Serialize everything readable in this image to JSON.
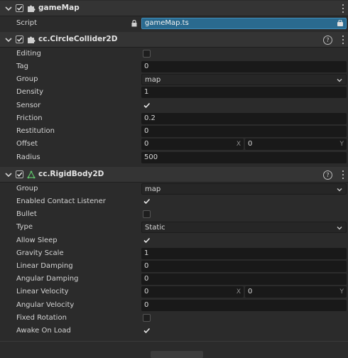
{
  "components": {
    "game_map": {
      "title": "gameMap",
      "script_label": "Script",
      "script_value": "gameMap.ts"
    },
    "circle_collider": {
      "title": "cc.CircleCollider2D",
      "help": "?",
      "props": {
        "editing": "Editing",
        "tag": "Tag",
        "tag_value": "0",
        "group": "Group",
        "group_value": "map",
        "density": "Density",
        "density_value": "1",
        "sensor": "Sensor",
        "friction": "Friction",
        "friction_value": "0.2",
        "restitution": "Restitution",
        "restitution_value": "0",
        "offset": "Offset",
        "offset_x": "0",
        "offset_y": "0",
        "radius": "Radius",
        "radius_value": "500"
      }
    },
    "rigid_body": {
      "title": "cc.RigidBody2D",
      "help": "?",
      "props": {
        "group": "Group",
        "group_value": "map",
        "enabled_contact_listener": "Enabled Contact Listener",
        "bullet": "Bullet",
        "type": "Type",
        "type_value": "Static",
        "allow_sleep": "Allow Sleep",
        "gravity_scale": "Gravity Scale",
        "gravity_scale_value": "1",
        "linear_damping": "Linear Damping",
        "linear_damping_value": "0",
        "angular_damping": "Angular Damping",
        "angular_damping_value": "0",
        "linear_velocity": "Linear Velocity",
        "linear_velocity_x": "0",
        "linear_velocity_y": "0",
        "angular_velocity": "Angular Velocity",
        "angular_velocity_value": "0",
        "fixed_rotation": "Fixed Rotation",
        "awake_on_load": "Awake On Load"
      }
    }
  },
  "axis": {
    "x": "X",
    "y": "Y"
  },
  "checkbox_states": {
    "game_map_enabled": true,
    "circle_collider_enabled": true,
    "rigid_body_enabled": true,
    "editing": false,
    "sensor": true,
    "enabled_contact_listener": true,
    "bullet": false,
    "allow_sleep": true,
    "fixed_rotation": false,
    "awake_on_load": true
  },
  "icons": {
    "collapse": "chevron-down-icon",
    "script_component": "puzzle-icon",
    "collider_component": "puzzle-icon",
    "rigidbody_component": "triangle-nodes-icon",
    "lock": "lock-icon",
    "help": "help-icon",
    "menu": "kebab-menu-icon"
  },
  "colors": {
    "background": "#2b2b2b",
    "header": "#343434",
    "input": "#191919",
    "script_field": "#2a6a8f",
    "rigidbody_icon": "#5fc26a"
  }
}
